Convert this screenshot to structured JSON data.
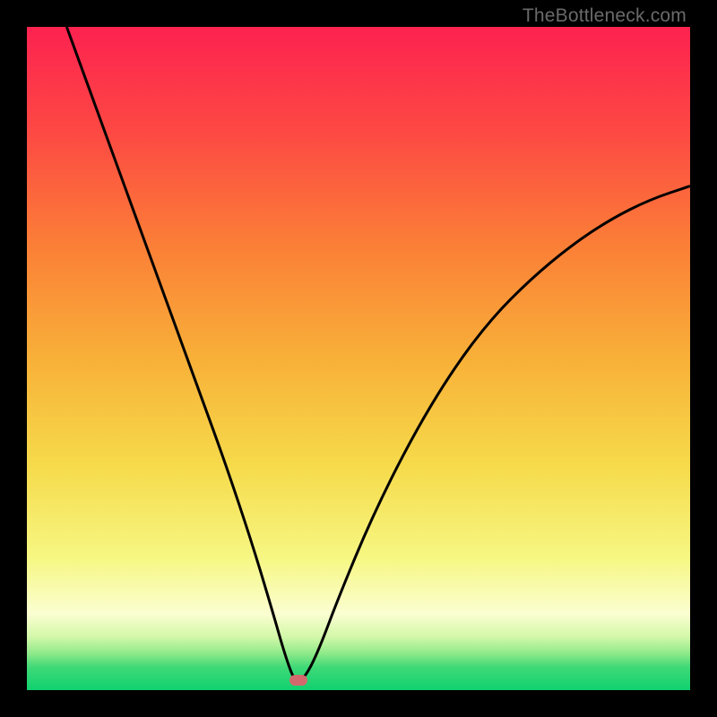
{
  "watermark": "TheBottleneck.com",
  "chart_data": {
    "type": "line",
    "title": "",
    "xlabel": "",
    "ylabel": "",
    "xlim": [
      0,
      100
    ],
    "ylim": [
      0,
      100
    ],
    "grid": false,
    "legend": false,
    "series": [
      {
        "name": "bottleneck-curve",
        "x": [
          6,
          10,
          14,
          18,
          22,
          26,
          30,
          34,
          37,
          39,
          40.5,
          42,
          44,
          47,
          52,
          58,
          64,
          70,
          76,
          82,
          88,
          94,
          100
        ],
        "y": [
          100,
          89,
          78,
          67,
          56,
          45,
          34,
          22,
          12,
          5,
          1,
          2,
          6,
          14,
          26,
          38,
          48,
          56,
          62,
          67,
          71,
          74,
          76
        ]
      }
    ],
    "marker": {
      "x": 41,
      "y": 1.5,
      "color": "#d26a6d"
    },
    "gradient_stops": [
      {
        "pos": 0.0,
        "color": "#fd2250"
      },
      {
        "pos": 0.16,
        "color": "#fd4943"
      },
      {
        "pos": 0.33,
        "color": "#fb7f37"
      },
      {
        "pos": 0.5,
        "color": "#f8b038"
      },
      {
        "pos": 0.66,
        "color": "#f6da4a"
      },
      {
        "pos": 0.8,
        "color": "#f6f782"
      },
      {
        "pos": 0.885,
        "color": "#fbfed1"
      },
      {
        "pos": 0.92,
        "color": "#d2f8a8"
      },
      {
        "pos": 0.945,
        "color": "#8ee989"
      },
      {
        "pos": 0.965,
        "color": "#41d977"
      },
      {
        "pos": 1.0,
        "color": "#0fd16f"
      }
    ],
    "curve_stroke": "#000000",
    "curve_width": 3
  }
}
